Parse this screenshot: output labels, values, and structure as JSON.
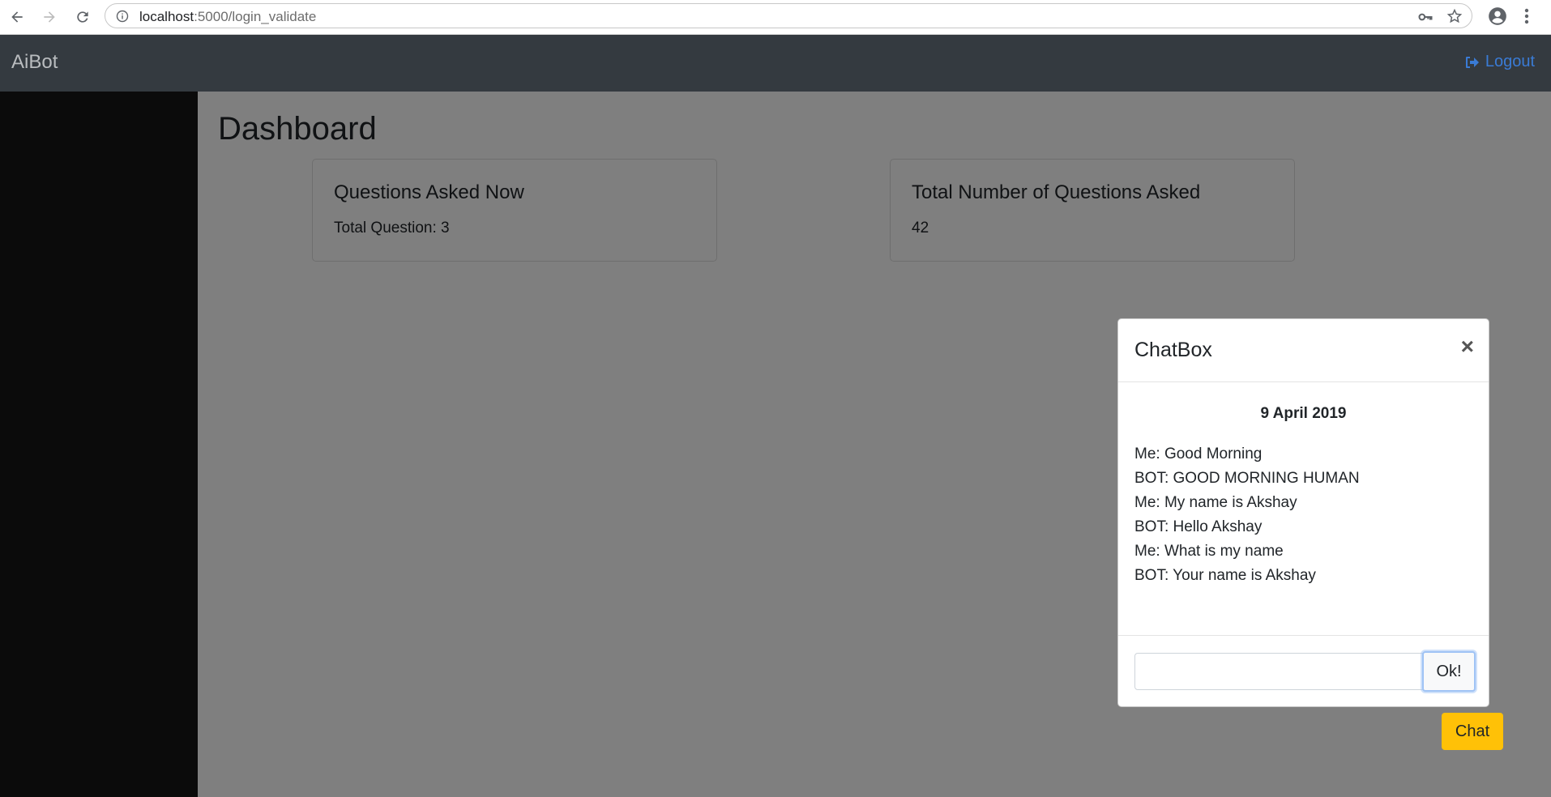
{
  "browser": {
    "url_host": "localhost",
    "url_rest": ":5000/login_validate"
  },
  "navbar": {
    "brand": "AiBot",
    "logout_label": "Logout"
  },
  "dashboard": {
    "title": "Dashboard",
    "cards": [
      {
        "title": "Questions Asked Now",
        "text": "Total Question: 3"
      },
      {
        "title": "Total Number of Questions Asked",
        "text": "42"
      }
    ],
    "chat_button_label": "Chat"
  },
  "chatbox": {
    "title": "ChatBox",
    "close_symbol": "×",
    "date": "9 April 2019",
    "messages": [
      "Me: Good Morning",
      "BOT: GOOD MORNING HUMAN",
      "Me: My name is Akshay",
      "BOT: Hello Akshay",
      "Me: What is my name",
      "BOT: Your name is Akshay"
    ],
    "input_value": "",
    "ok_label": "Ok!"
  },
  "colors": {
    "navbar_bg": "#343a40",
    "sidebar_bg": "#0b0b0b",
    "logout_link": "#3a7bd5",
    "chat_button": "#ffc107",
    "overlay": "rgba(0,0,0,0.5)"
  }
}
